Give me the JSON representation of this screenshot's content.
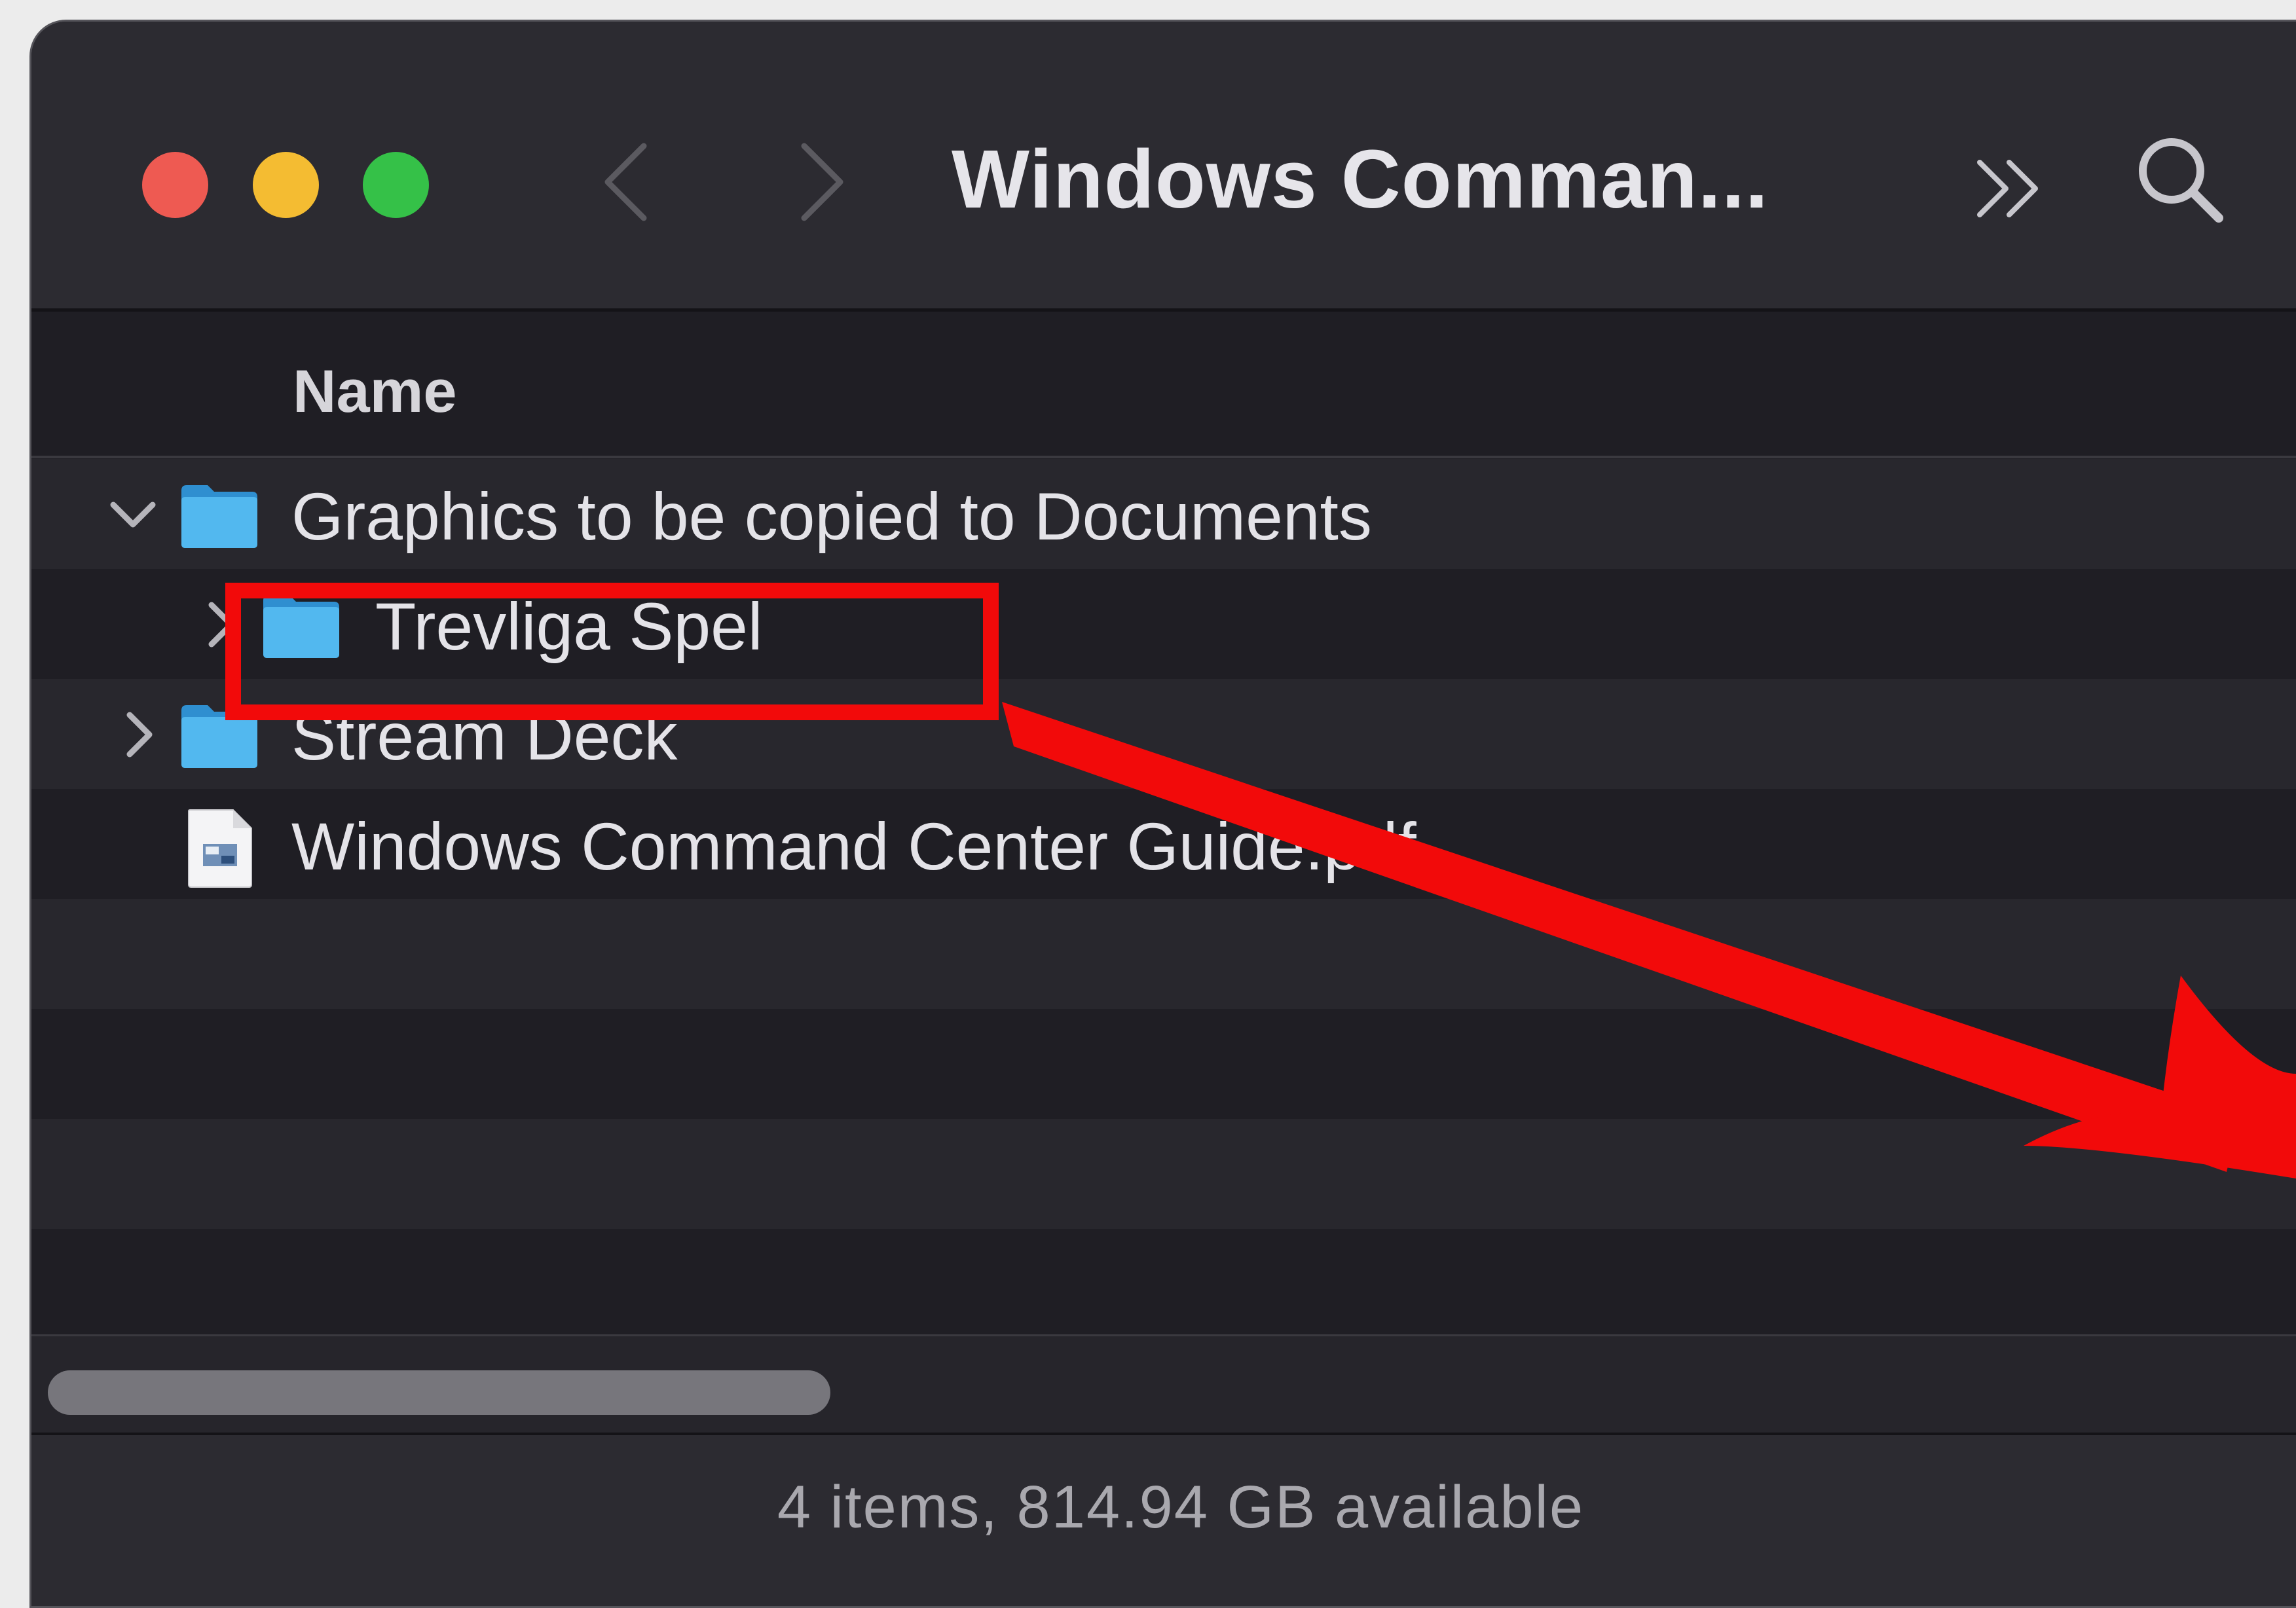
{
  "window": {
    "title": "Windows Comman...",
    "traffic_lights": {
      "close_color": "#ee5a52",
      "minimize_color": "#f4bc32",
      "maximize_color": "#35c148"
    }
  },
  "toolbar": {
    "back_icon": "chevron-left-icon",
    "forward_icon": "chevron-right-icon",
    "more_icon": "double-chevron-right-icon",
    "search_icon": "magnifier-icon"
  },
  "columns": {
    "name": "Name"
  },
  "rows": [
    {
      "label": "Graphics to be copied to Documents",
      "kind": "folder",
      "expanded": true,
      "level": 0
    },
    {
      "label": "Trevliga Spel",
      "kind": "folder",
      "expanded": false,
      "level": 1
    },
    {
      "label": "Stream Deck",
      "kind": "folder",
      "expanded": false,
      "level": 0
    },
    {
      "label": "Windows Command Center Guide.pdf",
      "kind": "pdf",
      "level": 0
    }
  ],
  "status": {
    "text": "4 items, 814.94 GB available"
  },
  "colors": {
    "folder_blue": "#4fb3ec",
    "annotation_red": "#f20a0a",
    "window_bg": "#1f1e24"
  },
  "annotation": {
    "highlight_icon": "red-highlight-rectangle",
    "arrow_icon": "red-arrow"
  }
}
